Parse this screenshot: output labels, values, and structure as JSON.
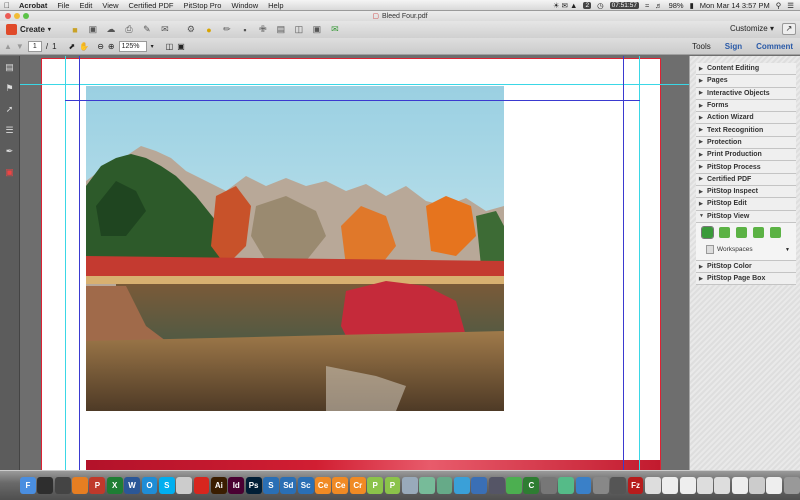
{
  "menubar": {
    "app": "Acrobat",
    "items": [
      "File",
      "Edit",
      "View",
      "Certified PDF",
      "PitStop Pro",
      "Window",
      "Help"
    ],
    "status": {
      "clock_app": "07:51:57",
      "battery": "98%",
      "datetime": "Mon Mar 14  3:57 PM",
      "badge": "2"
    }
  },
  "window": {
    "title": "Bleed Four.pdf"
  },
  "toolbar1": {
    "create_label": "Create",
    "customize_label": "Customize"
  },
  "toolbar2": {
    "page_current": "1",
    "page_sep": "/",
    "page_total": "1",
    "zoom": "125%"
  },
  "tabs": {
    "tools": "Tools",
    "sign": "Sign",
    "comment": "Comment"
  },
  "panel": {
    "items": [
      {
        "label": "Content Editing"
      },
      {
        "label": "Pages"
      },
      {
        "label": "Interactive Objects"
      },
      {
        "label": "Forms"
      },
      {
        "label": "Action Wizard"
      },
      {
        "label": "Text Recognition"
      },
      {
        "label": "Protection"
      },
      {
        "label": "Print Production"
      },
      {
        "label": "PitStop Process"
      },
      {
        "label": "Certified PDF"
      },
      {
        "label": "PitStop Inspect"
      },
      {
        "label": "PitStop Edit"
      },
      {
        "label": "PitStop View"
      }
    ],
    "pitstop_view": {
      "workspaces": "Workspaces"
    },
    "after": [
      {
        "label": "PitStop Color"
      },
      {
        "label": "PitStop Page Box"
      }
    ]
  },
  "dock": {
    "apps": [
      {
        "t": "F",
        "c": "#4a8ee0"
      },
      {
        "t": "",
        "c": "#2e2e2e"
      },
      {
        "t": "",
        "c": "#444"
      },
      {
        "t": "",
        "c": "#e67e22"
      },
      {
        "t": "P",
        "c": "#c0392b"
      },
      {
        "t": "X",
        "c": "#1e7e34"
      },
      {
        "t": "W",
        "c": "#2b5797"
      },
      {
        "t": "O",
        "c": "#1f8dd6"
      },
      {
        "t": "S",
        "c": "#00aff0"
      },
      {
        "t": "",
        "c": "#ccc"
      },
      {
        "t": "",
        "c": "#d7261e"
      },
      {
        "t": "Ai",
        "c": "#3a1d00"
      },
      {
        "t": "Id",
        "c": "#4a0032"
      },
      {
        "t": "Ps",
        "c": "#001e36"
      },
      {
        "t": "S",
        "c": "#2a6fb5"
      },
      {
        "t": "Sd",
        "c": "#2a6fb5"
      },
      {
        "t": "Sc",
        "c": "#2a6fb5"
      },
      {
        "t": "Ce",
        "c": "#f08a24"
      },
      {
        "t": "Ce",
        "c": "#f08a24"
      },
      {
        "t": "Cr",
        "c": "#f08a24"
      },
      {
        "t": "P",
        "c": "#8bc34a"
      },
      {
        "t": "P",
        "c": "#8bc34a"
      },
      {
        "t": "",
        "c": "#9ab"
      },
      {
        "t": "",
        "c": "#7b9"
      },
      {
        "t": "",
        "c": "#6a8"
      },
      {
        "t": "",
        "c": "#3aa0d8"
      },
      {
        "t": "",
        "c": "#3a6fb5"
      },
      {
        "t": "",
        "c": "#556"
      },
      {
        "t": "",
        "c": "#4caf50"
      },
      {
        "t": "C",
        "c": "#2e7d32"
      },
      {
        "t": "",
        "c": "#777"
      },
      {
        "t": "",
        "c": "#5b8"
      },
      {
        "t": "",
        "c": "#3a80c8"
      },
      {
        "t": "",
        "c": "#888"
      },
      {
        "t": "",
        "c": "#555"
      },
      {
        "t": "Fz",
        "c": "#b71c1c"
      },
      {
        "t": "",
        "c": "#ddd"
      },
      {
        "t": "",
        "c": "#eee"
      },
      {
        "t": "",
        "c": "#eee"
      },
      {
        "t": "",
        "c": "#ddd"
      },
      {
        "t": "",
        "c": "#ddd"
      },
      {
        "t": "",
        "c": "#eee"
      },
      {
        "t": "",
        "c": "#ccc"
      },
      {
        "t": "",
        "c": "#eee"
      },
      {
        "t": "",
        "c": "#999"
      }
    ]
  }
}
